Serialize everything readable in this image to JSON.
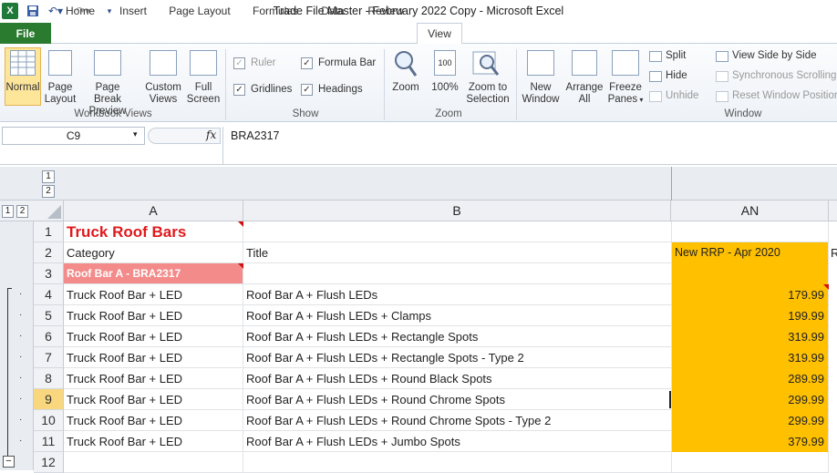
{
  "window": {
    "title": "Trade File Master - February 2022 Copy  -  Microsoft Excel"
  },
  "tabs": [
    "File",
    "Home",
    "Insert",
    "Page Layout",
    "Formulas",
    "Data",
    "Review",
    "View"
  ],
  "ribbon": {
    "workbook_views": {
      "label": "Workbook Views",
      "normal": "Normal",
      "page_layout_1": "Page",
      "page_layout_2": "Layout",
      "page_break_1": "Page Break",
      "page_break_2": "Preview",
      "custom_1": "Custom",
      "custom_2": "Views",
      "full_1": "Full",
      "full_2": "Screen"
    },
    "show": {
      "label": "Show",
      "ruler": "Ruler",
      "formula_bar": "Formula Bar",
      "gridlines": "Gridlines",
      "headings": "Headings"
    },
    "zoom": {
      "label": "Zoom",
      "zoom": "Zoom",
      "hundred": "100%",
      "sel_1": "Zoom to",
      "sel_2": "Selection"
    },
    "window": {
      "label": "Window",
      "new_1": "New",
      "new_2": "Window",
      "arrange_1": "Arrange",
      "arrange_2": "All",
      "freeze_1": "Freeze",
      "freeze_2": "Panes",
      "split": "Split",
      "hide": "Hide",
      "unhide": "Unhide",
      "side": "View Side by Side",
      "sync": "Synchronous Scrolling",
      "reset": "Reset Window Position"
    }
  },
  "formula_bar": {
    "name_box": "C9",
    "fx": "fx",
    "value": "BRA2317"
  },
  "outline_levels": [
    "1",
    "2"
  ],
  "columns": {
    "a": "A",
    "b": "B",
    "an": "AN"
  },
  "rows": [
    {
      "n": "1",
      "a": "Truck Roof Bars",
      "b": "",
      "an": ""
    },
    {
      "n": "2",
      "a": "Category",
      "b": "Title",
      "an": "New RRP - Apr 2020"
    },
    {
      "n": "3",
      "a": "Roof Bar A - BRA2317",
      "b": "",
      "an": ""
    },
    {
      "n": "4",
      "a": "Truck Roof Bar + LED",
      "b": "Roof Bar A + Flush LEDs",
      "an": "179.99"
    },
    {
      "n": "5",
      "a": "Truck Roof Bar + LED",
      "b": "Roof Bar A + Flush LEDs + Clamps",
      "an": "199.99"
    },
    {
      "n": "6",
      "a": "Truck Roof Bar + LED",
      "b": "Roof Bar A + Flush LEDs + Rectangle Spots",
      "an": "319.99"
    },
    {
      "n": "7",
      "a": "Truck Roof Bar + LED",
      "b": "Roof Bar A + Flush LEDs + Rectangle Spots - Type 2",
      "an": "319.99"
    },
    {
      "n": "8",
      "a": "Truck Roof Bar + LED",
      "b": "Roof Bar A + Flush LEDs + Round Black Spots",
      "an": "289.99"
    },
    {
      "n": "9",
      "a": "Truck Roof Bar + LED",
      "b": "Roof Bar A + Flush LEDs + Round Chrome Spots",
      "an": "299.99"
    },
    {
      "n": "10",
      "a": "Truck Roof Bar + LED",
      "b": "Roof Bar A + Flush LEDs + Round Chrome Spots - Type 2",
      "an": "299.99"
    },
    {
      "n": "11",
      "a": "Truck Roof Bar + LED",
      "b": "Roof Bar A + Flush LEDs + Jumbo Spots",
      "an": "379.99"
    },
    {
      "n": "12",
      "a": "",
      "b": "",
      "an": ""
    }
  ],
  "next_col_partial": "R",
  "colors": {
    "title_red": "#e0191e",
    "highlight_salmon": "#f38b8a",
    "orange": "#ffc000",
    "file_green": "#2a7a30",
    "selected_row": "#f9d77e"
  }
}
